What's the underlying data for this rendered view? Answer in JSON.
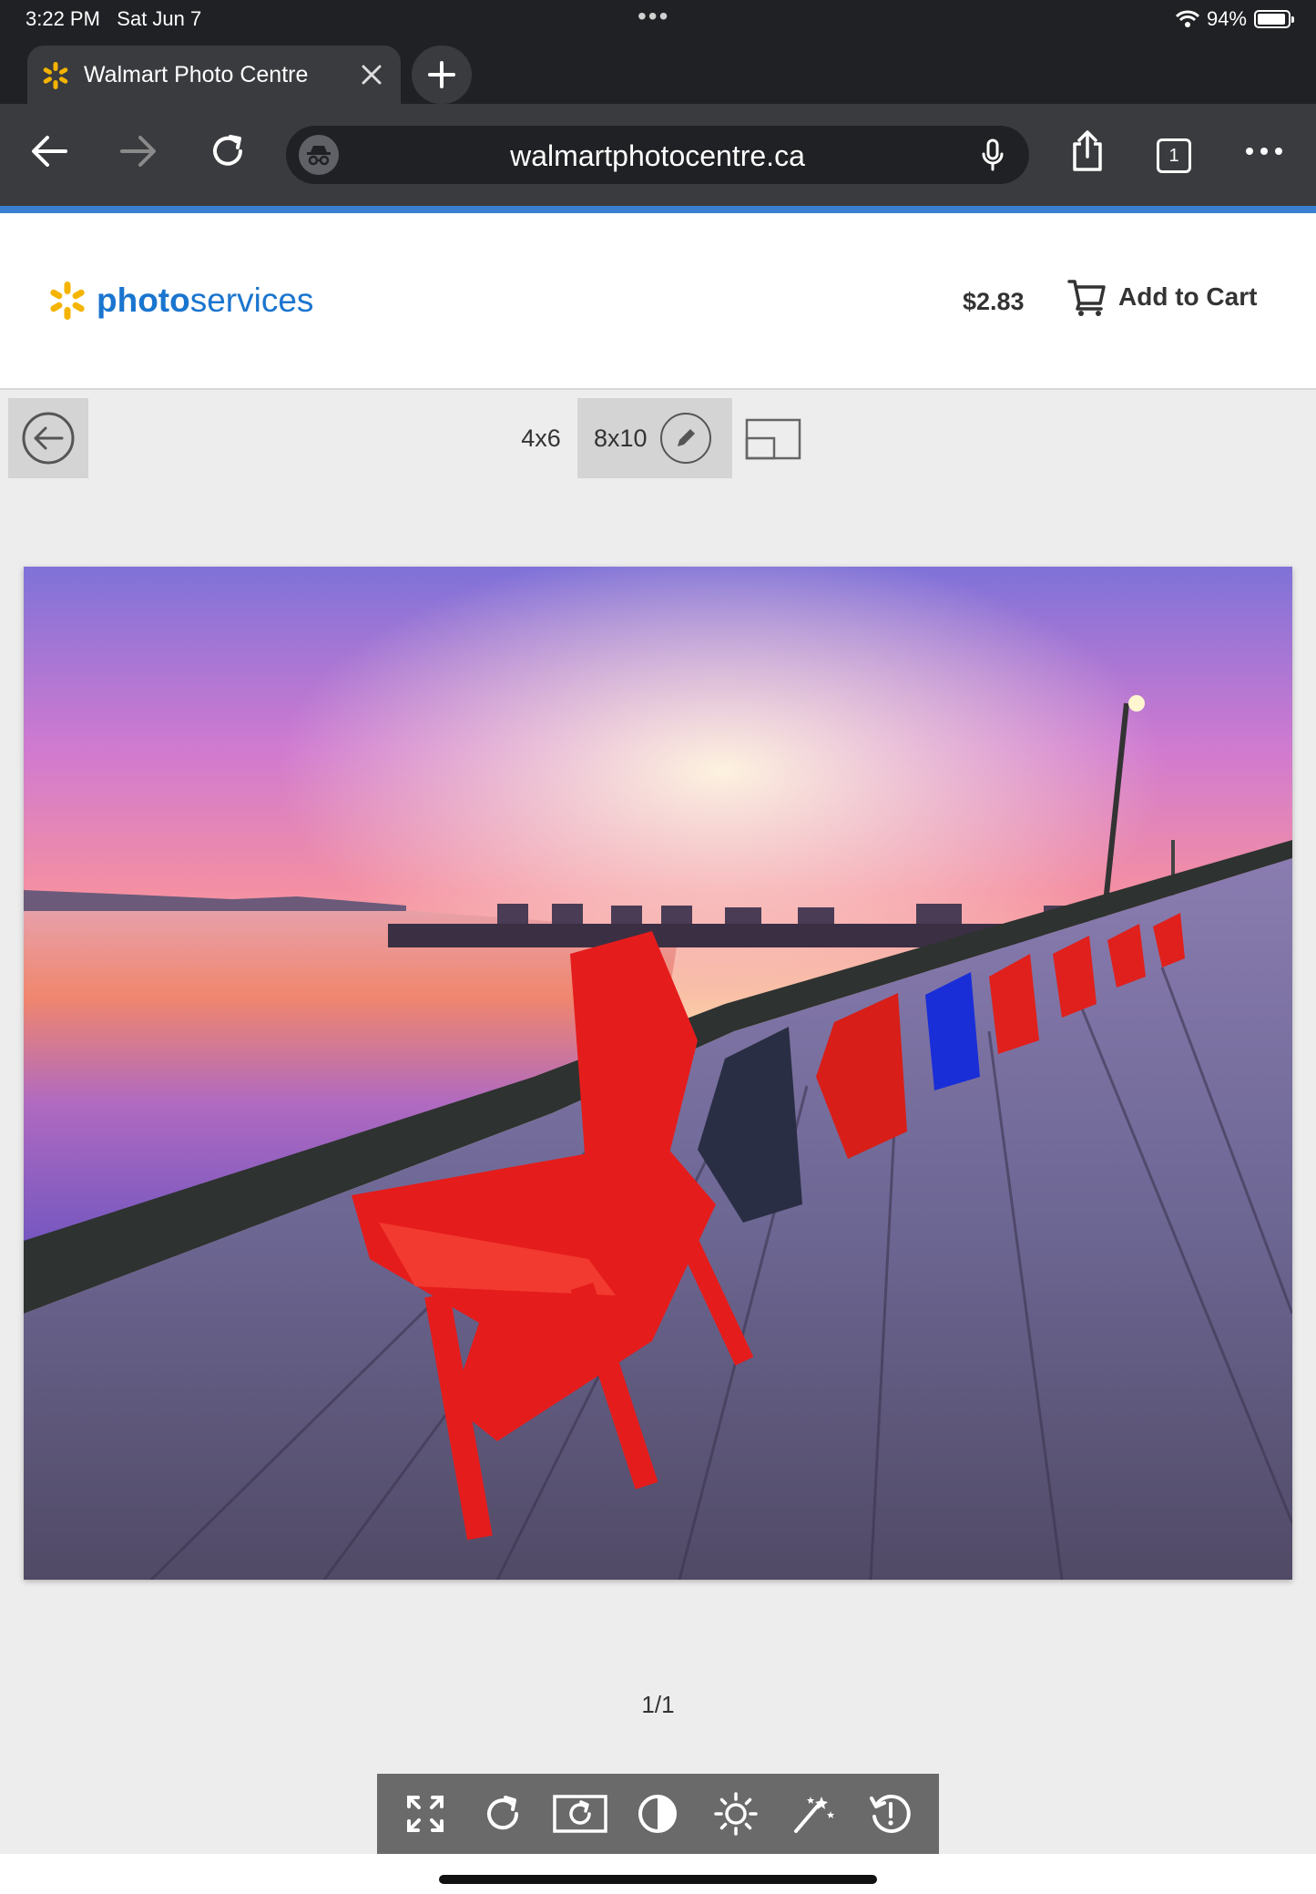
{
  "status_bar": {
    "time": "3:22 PM",
    "date": "Sat Jun 7",
    "battery": "94%",
    "battery_level": 0.94,
    "icons": [
      "wifi-icon",
      "battery-icon"
    ]
  },
  "browser": {
    "tab_title": "Walmart Photo Centre",
    "url": "walmartphotocentre.ca",
    "tab_count": "1",
    "icons": [
      "walmart-spark-icon",
      "close-icon",
      "plus-icon",
      "back-arrow-icon",
      "forward-arrow-icon",
      "reload-icon",
      "incognito-icon",
      "mic-icon",
      "share-icon",
      "more-icon"
    ]
  },
  "header": {
    "logo_bold": "photo",
    "logo_regular": "services",
    "price": "$2.83",
    "add_to_cart": "Add to Cart",
    "brand_color": "#1a75cf",
    "spark_color": "#f5b400"
  },
  "editor": {
    "sizes": [
      "4x6",
      "8x10"
    ],
    "selected_size": "8x10",
    "page_indicator": "1/1",
    "tools": [
      "fullscreen-icon",
      "rotate-icon",
      "rotate-photo-icon",
      "contrast-icon",
      "brightness-icon",
      "magic-wand-icon",
      "reset-icon"
    ]
  },
  "photo": {
    "subject": "sunset boardwalk with red and blue Adirondack chairs"
  }
}
